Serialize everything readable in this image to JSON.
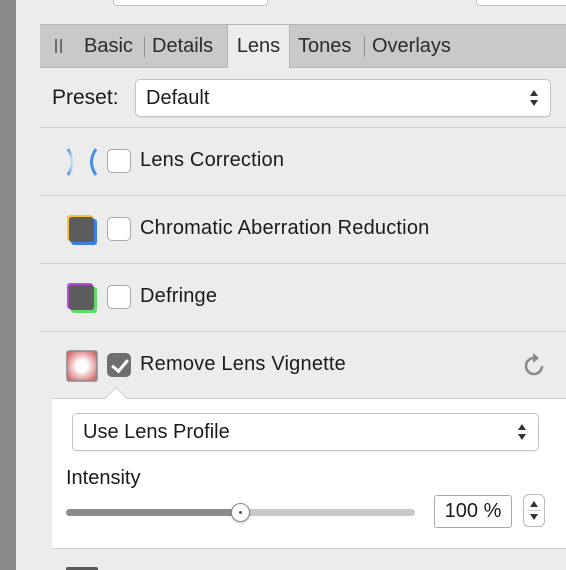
{
  "tabs": {
    "items": [
      {
        "label": "Basic"
      },
      {
        "label": "Details"
      },
      {
        "label": "Lens",
        "active": true
      },
      {
        "label": "Tones"
      },
      {
        "label": "Overlays"
      }
    ]
  },
  "preset": {
    "label": "Preset:",
    "value": "Default"
  },
  "lens_rows": [
    {
      "label": "Lens Correction",
      "checked": false,
      "icon": "lens-correction-icon"
    },
    {
      "label": "Chromatic Aberration Reduction",
      "checked": false,
      "icon": "chromatic-aberration-icon"
    },
    {
      "label": "Defringe",
      "checked": false,
      "icon": "defringe-icon"
    },
    {
      "label": "Remove Lens Vignette",
      "checked": true,
      "icon": "vignette-icon"
    }
  ],
  "vignette": {
    "mode": "Use Lens Profile",
    "intensity_label": "Intensity",
    "intensity_value": "100 %",
    "slider_fraction": 0.5
  },
  "colors": {
    "tab_bar": "#c9c9c9",
    "panel": "#ececec",
    "checkbox_checked": "#6f6f6f"
  }
}
